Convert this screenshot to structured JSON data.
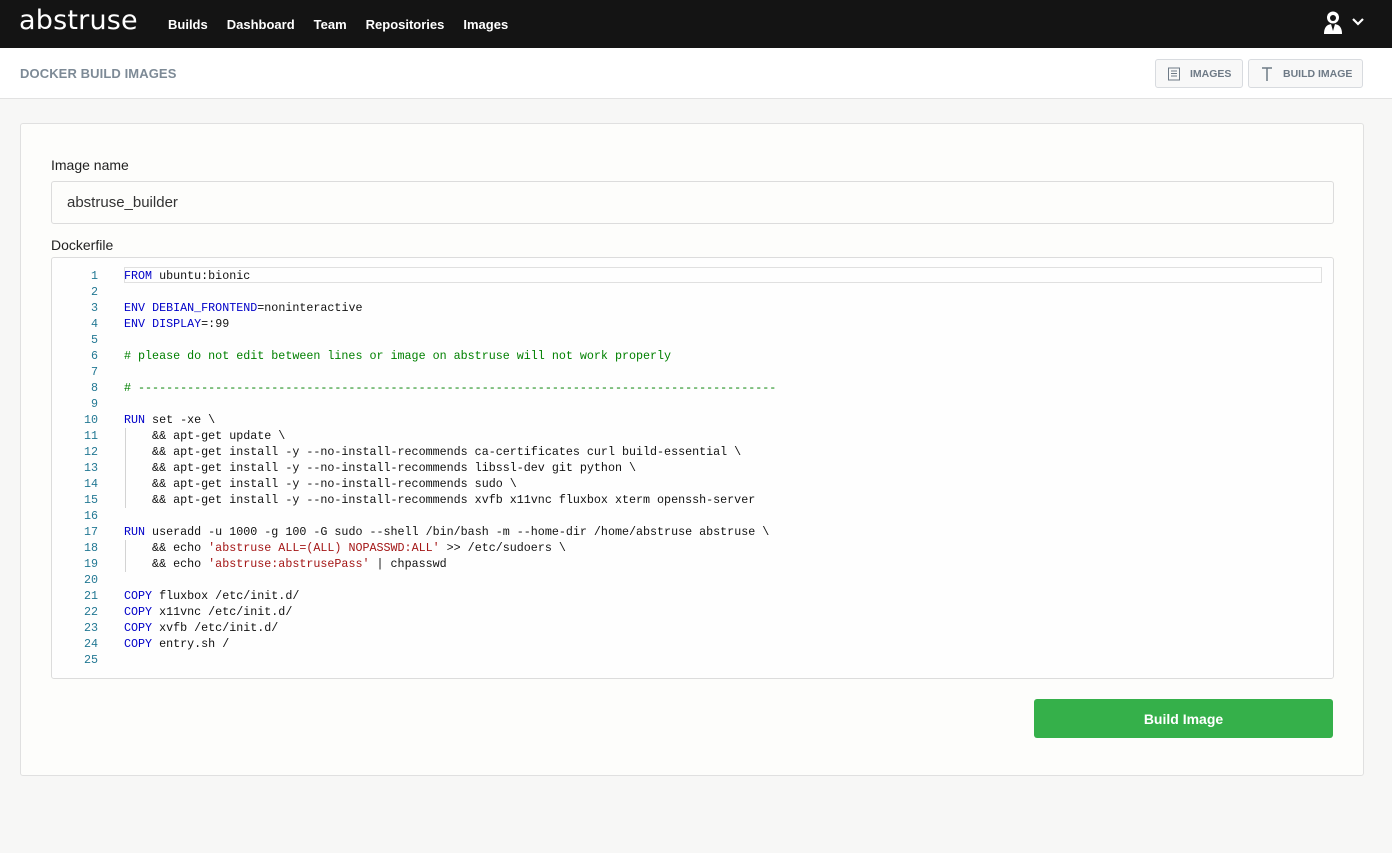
{
  "app": {
    "logo": "abstruse",
    "nav": [
      "Builds",
      "Dashboard",
      "Team",
      "Repositories",
      "Images"
    ]
  },
  "header": {
    "title": "DOCKER BUILD IMAGES",
    "images_label": "IMAGES",
    "build_image_label": "BUILD IMAGE"
  },
  "form": {
    "image_name_label": "Image name",
    "image_name_value": "abstruse_builder",
    "dockerfile_label": "Dockerfile",
    "submit_label": "Build Image"
  },
  "dockerfile": [
    [
      [
        "kw",
        "FROM"
      ],
      [
        "",
        " ubuntu:bionic"
      ]
    ],
    [],
    [
      [
        "kw",
        "ENV"
      ],
      [
        "",
        " "
      ],
      [
        "kw",
        "DEBIAN_FRONTEND"
      ],
      [
        "",
        "=noninteractive"
      ]
    ],
    [
      [
        "kw",
        "ENV"
      ],
      [
        "",
        " "
      ],
      [
        "kw",
        "DISPLAY"
      ],
      [
        "",
        "=:99"
      ]
    ],
    [],
    [
      [
        "cm",
        "# please do not edit between lines or image on abstruse will not work properly"
      ]
    ],
    [],
    [
      [
        "cm",
        "# -------------------------------------------------------------------------------------------"
      ]
    ],
    [],
    [
      [
        "kw",
        "RUN"
      ],
      [
        "",
        " set -xe \\"
      ]
    ],
    [
      [
        "",
        "    && apt-get update \\"
      ]
    ],
    [
      [
        "",
        "    && apt-get install -y --no-install-recommends ca-certificates curl build-essential \\"
      ]
    ],
    [
      [
        "",
        "    && apt-get install -y --no-install-recommends libssl-dev git python \\"
      ]
    ],
    [
      [
        "",
        "    && apt-get install -y --no-install-recommends sudo \\"
      ]
    ],
    [
      [
        "",
        "    && apt-get install -y --no-install-recommends xvfb x11vnc fluxbox xterm openssh-server"
      ]
    ],
    [],
    [
      [
        "kw",
        "RUN"
      ],
      [
        "",
        " useradd -u 1000 -g 100 -G sudo --shell /bin/bash -m --home-dir /home/abstruse abstruse \\"
      ]
    ],
    [
      [
        "",
        "    && echo "
      ],
      [
        "str",
        "'abstruse ALL=(ALL) NOPASSWD:ALL'"
      ],
      [
        "",
        " >> /etc/sudoers \\"
      ]
    ],
    [
      [
        "",
        "    && echo "
      ],
      [
        "str",
        "'abstruse:abstrusePass'"
      ],
      [
        "",
        " | chpasswd"
      ]
    ],
    [],
    [
      [
        "kw",
        "COPY"
      ],
      [
        "",
        " fluxbox /etc/init.d/"
      ]
    ],
    [
      [
        "kw",
        "COPY"
      ],
      [
        "",
        " x11vnc /etc/init.d/"
      ]
    ],
    [
      [
        "kw",
        "COPY"
      ],
      [
        "",
        " xvfb /etc/init.d/"
      ]
    ],
    [
      [
        "kw",
        "COPY"
      ],
      [
        "",
        " entry.sh /"
      ]
    ],
    []
  ]
}
